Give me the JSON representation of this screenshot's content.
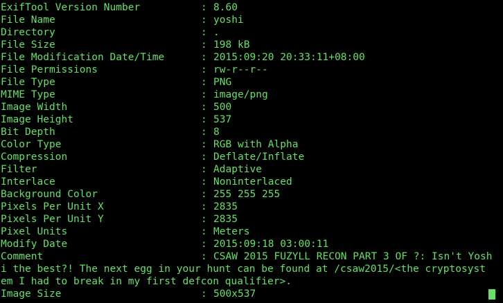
{
  "terminal": {
    "rows": [
      {
        "key": "ExifTool Version Number",
        "value": "8.60"
      },
      {
        "key": "File Name",
        "value": "yoshi"
      },
      {
        "key": "Directory",
        "value": "."
      },
      {
        "key": "File Size",
        "value": "198 kB"
      },
      {
        "key": "File Modification Date/Time",
        "value": "2015:09:20 20:33:11+08:00"
      },
      {
        "key": "File Permissions",
        "value": "rw-r--r--"
      },
      {
        "key": "File Type",
        "value": "PNG"
      },
      {
        "key": "MIME Type",
        "value": "image/png"
      },
      {
        "key": "Image Width",
        "value": "500"
      },
      {
        "key": "Image Height",
        "value": "537"
      },
      {
        "key": "Bit Depth",
        "value": "8"
      },
      {
        "key": "Color Type",
        "value": "RGB with Alpha"
      },
      {
        "key": "Compression",
        "value": "Deflate/Inflate"
      },
      {
        "key": "Filter",
        "value": "Adaptive"
      },
      {
        "key": "Interlace",
        "value": "Noninterlaced"
      },
      {
        "key": "Background Color",
        "value": "255 255 255"
      },
      {
        "key": "Pixels Per Unit X",
        "value": "2835"
      },
      {
        "key": "Pixels Per Unit Y",
        "value": "2835"
      },
      {
        "key": "Pixel Units",
        "value": "Meters"
      },
      {
        "key": "Modify Date",
        "value": "2015:09:18 03:00:11"
      },
      {
        "key": "Comment",
        "value": "CSAW 2015 FUZYLL RECON PART 3 OF ?: Isn't Yosh"
      }
    ],
    "wrap_lines": [
      "i the best?! The next egg in your hunt can be found at /csaw2015/<the cryptosyst",
      "em I had to break in my first defcon qualifier>."
    ],
    "last_row": {
      "key": "Image Size",
      "value": "500x537"
    },
    "separator": ":",
    "colors": {
      "text": "#66e066",
      "background": "#000000",
      "prompt_red": "#e04040"
    }
  }
}
